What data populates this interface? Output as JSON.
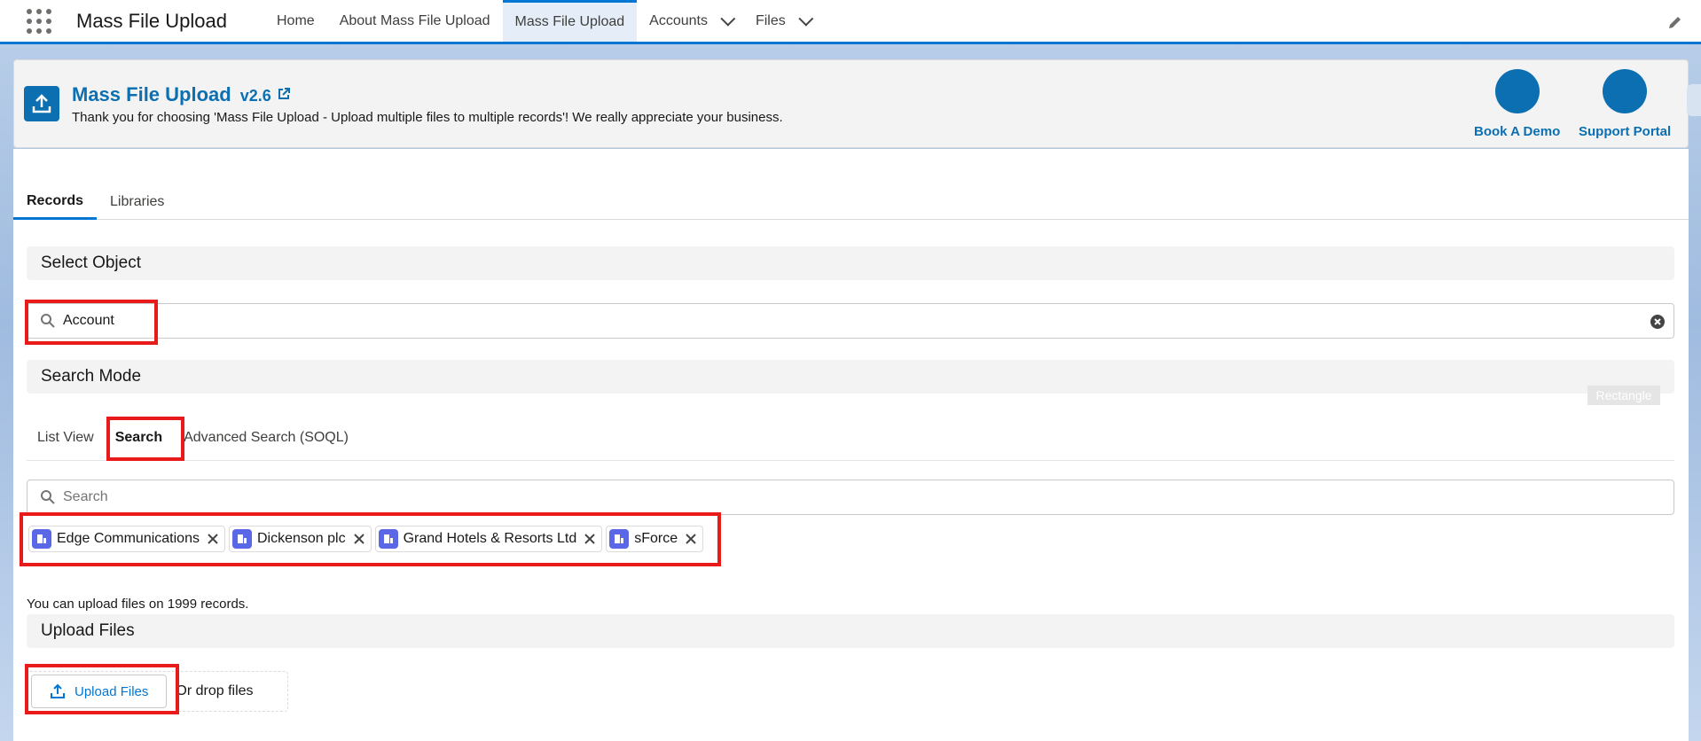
{
  "nav": {
    "app_name": "Mass File Upload",
    "items": [
      {
        "label": "Home",
        "active": false,
        "dropdown": false
      },
      {
        "label": "About Mass File Upload",
        "active": false,
        "dropdown": false
      },
      {
        "label": "Mass File Upload",
        "active": true,
        "dropdown": false
      },
      {
        "label": "Accounts",
        "active": false,
        "dropdown": true
      },
      {
        "label": "Files",
        "active": false,
        "dropdown": true
      }
    ]
  },
  "header": {
    "title": "Mass File Upload",
    "version": "v2.6",
    "subtitle": "Thank you for choosing 'Mass File Upload - Upload multiple files to multiple records'! We really appreciate your business.",
    "book_demo": "Book A Demo",
    "support_portal": "Support Portal"
  },
  "tabs": [
    {
      "label": "Records",
      "active": true
    },
    {
      "label": "Libraries",
      "active": false
    }
  ],
  "select_object": {
    "title": "Select Object",
    "value": "Account"
  },
  "search_mode": {
    "title": "Search Mode",
    "tabs": [
      {
        "label": "List View",
        "active": false
      },
      {
        "label": "Search",
        "active": true
      },
      {
        "label": "Advanced Search (SOQL)",
        "active": false
      }
    ],
    "search_placeholder": "Search",
    "annotation_label": "Rectangle"
  },
  "selected_records": [
    "Edge Communications",
    "Dickenson plc",
    "Grand Hotels & Resorts Ltd",
    "sForce"
  ],
  "note": "You can upload files on 1999 records.",
  "upload": {
    "title": "Upload Files",
    "button_label": "Upload Files",
    "drop_text": "Or drop files"
  },
  "colors": {
    "brand": "#0b6fb1",
    "accent": "#0176d3",
    "highlight": "#e81a1a",
    "account_icon": "#5a67e6"
  }
}
